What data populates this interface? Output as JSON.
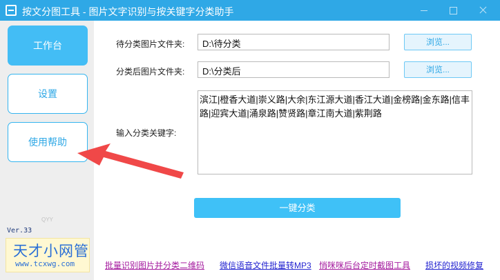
{
  "window": {
    "title": "按文分图工具 - 图片文字识别与按关键字分类助手"
  },
  "sidebar": {
    "items": [
      {
        "label": "工作台",
        "active": true
      },
      {
        "label": "设置",
        "active": false
      },
      {
        "label": "使用帮助",
        "active": false
      }
    ],
    "version": "Ver.33",
    "watermark": "QYY",
    "logo": {
      "name": "天才小网管",
      "url": "www.tcxwg.com"
    }
  },
  "form": {
    "source_label": "待分类图片文件夹:",
    "source_value": "D:\\待分类",
    "dest_label": "分类后图片文件夹:",
    "dest_value": "D:\\分类后",
    "browse_label": "浏览...",
    "keywords_label": "输入分类关键字:",
    "keywords_value": "滨江|橙香大道|崇义路|大余|东江源大道|香江大道|金榜路|金东路|信丰路|迎宾大道|涌泉路|赞贤路|章江南大道|紫荆路",
    "run_label": "一键分类"
  },
  "footer": {
    "links": [
      "批量识别图片并分类二维码",
      "微信语音文件批量转MP3",
      "悄咪咪后台定时截图工具",
      "损坏的视频修复"
    ]
  },
  "colors": {
    "accent": "#2fa8e6",
    "active_nav": "#43bdf5",
    "arrow": "#f04848"
  }
}
